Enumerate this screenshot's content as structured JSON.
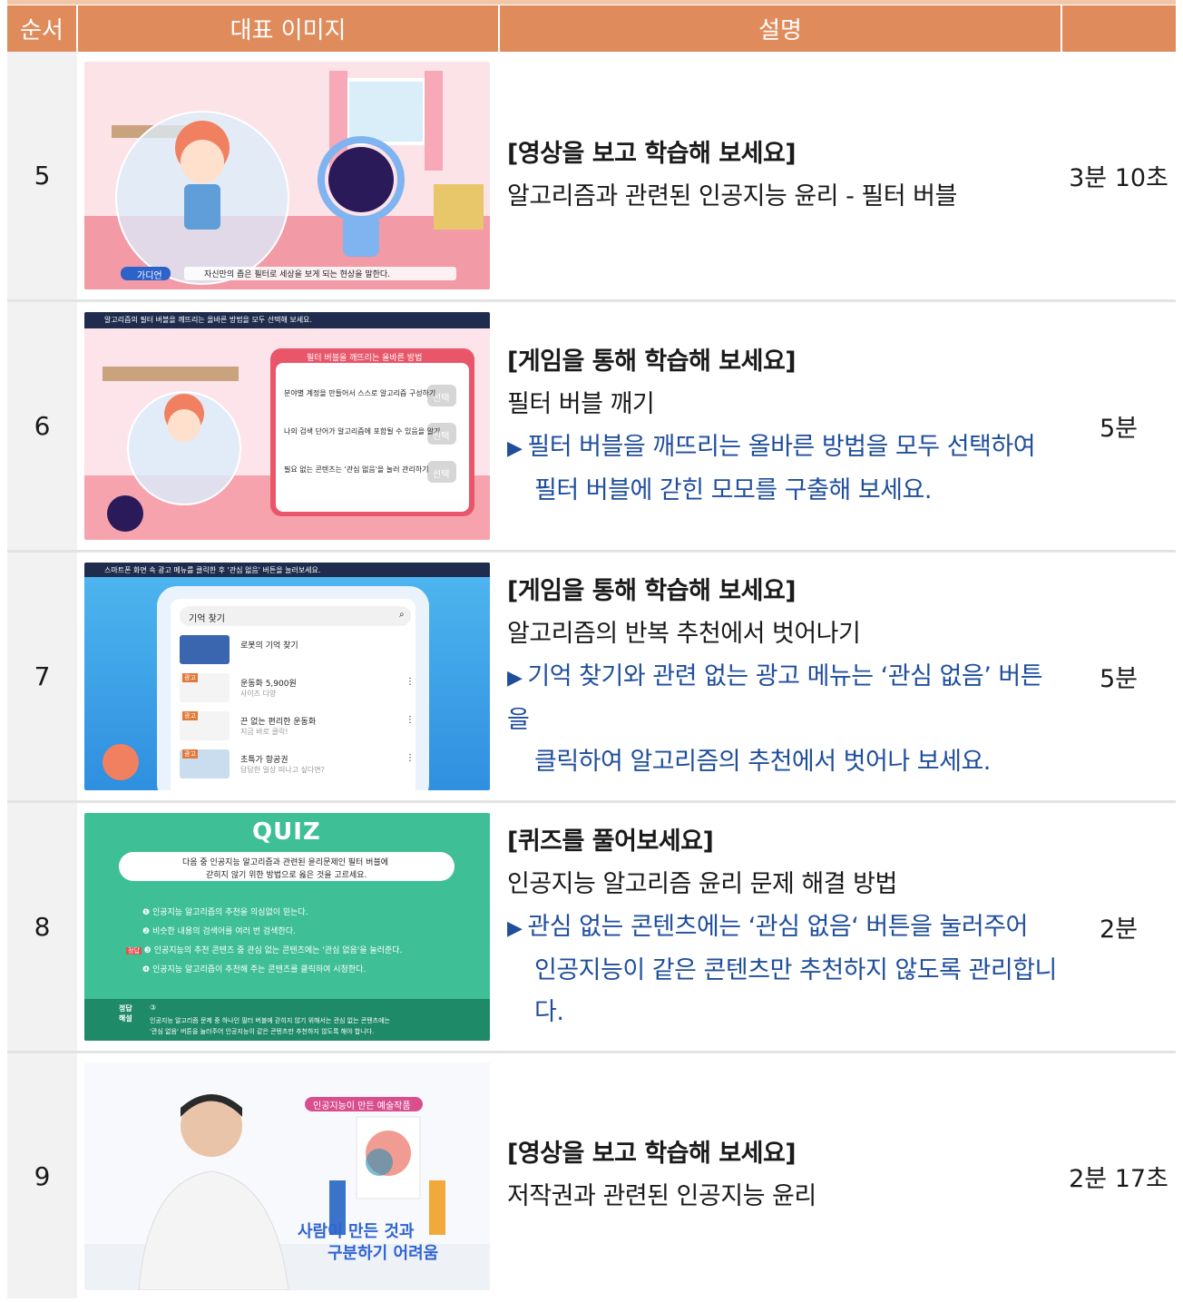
{
  "header": {
    "col_order": "순서",
    "col_image": "대표 이미지",
    "col_desc": "설명",
    "col_time": ""
  },
  "rows": [
    {
      "num": "5",
      "title": "[영상을 보고 학습해 보세요]",
      "subtitle": "알고리즘과 관련된 인공지능 윤리 - 필터 버블",
      "note1": "",
      "note2": "",
      "time": "3분 10초",
      "thumb": {
        "tag": "가디언",
        "caption": "자신만의 좁은 필터로 세상을 보게 되는 현상을 말한다."
      }
    },
    {
      "num": "6",
      "title": "[게임을 통해 학습해 보세요]",
      "subtitle": "필터 버블 깨기",
      "note1": "필터 버블을 깨뜨리는 올바른 방법을 모두 선택하여",
      "note2": "필터 버블에 갇힌 모모를 구출해 보세요.",
      "time": "5분",
      "thumb": {
        "topbar": "알고리즘의 필터 버블을 깨뜨리는 올바른 방법을 모두 선택해 보세요.",
        "panel_title": "필터 버블을 깨뜨리는 올바른 방법",
        "opt1": "분야별 계정을 만들어서 스스로 알고리즘 구성하기",
        "opt2": "나의 검색 단어가 알고리즘에 포함될 수 있음을 알기",
        "opt3": "필요 없는 콘텐츠는 '관심 없음'을 눌러 관리하기",
        "btn": "선택"
      }
    },
    {
      "num": "7",
      "title": "[게임을 통해 학습해 보세요]",
      "subtitle": "알고리즘의 반복 추천에서 벗어나기",
      "note1": "기억 찾기와 관련 없는 광고 메뉴는 ‘관심 없음’ 버튼을",
      "note2": "클릭하여 알고리즘의 추천에서 벗어나 보세요.",
      "time": "5분",
      "thumb": {
        "topbar": "스마트폰 화면 속 광고 메뉴를 클릭한 후 '관심 없음' 버튼을 눌러보세요.",
        "search": "기억 찾기",
        "item1": "로봇의 기억 찾기",
        "item2": "운동화 5,900원",
        "item2s": "사이즈 다양",
        "item3": "끈 없는 편리한 운동화",
        "item3s": "지금 바로 클릭!",
        "item4": "초특가 항공권",
        "item4s": "답답한 일상 떠나고 싶다면?",
        "ad": "광고"
      }
    },
    {
      "num": "8",
      "title": "[퀴즈를 풀어보세요]",
      "subtitle": "인공지능 알고리즘 윤리 문제 해결 방법",
      "note1": "관심 없는 콘텐츠에는 ‘관심 없음‘ 버튼을 눌러주어",
      "note2": "인공지능이 같은 콘텐츠만 추천하지 않도록 관리합니다.",
      "time": "2분",
      "thumb": {
        "logo": "QUIZ",
        "question1": "다음 중 인공지능 알고리즘과 관련된 윤리문제인 필터 버블에",
        "question2": "갇히지 않기 위한 방법으로 옳은 것을 고르세요.",
        "a1": "인공지능 알고리즘의 추천을 의심없이 믿는다.",
        "a2": "비슷한 내용의 검색어를 여러 번 검색한다.",
        "a3": "인공지능의 추천 콘텐츠 중 관심 없는 콘텐츠에는 '관심 없음'을 눌러준다.",
        "a4": "인공지능 알고리즘이 추천해 주는 콘텐츠를 클릭하여 시청한다.",
        "answer_tag": "정답",
        "expl_label": "정답 해설",
        "expl_num": "③",
        "expl1": "인공지능 알고리즘 문제 중 하나인 필터 버블에 갇히지 않기 위해서는 관심 없는 콘텐츠에는",
        "expl2": "'관심 없음' 버튼을 눌러주어 인공지능이 같은 콘텐츠만 추천하지 않도록 해야 합니다."
      }
    },
    {
      "num": "9",
      "title": "[영상을 보고 학습해 보세요]",
      "subtitle": "저작권과 관련된 인공지능 윤리",
      "note1": "",
      "note2": "",
      "time": "2분 17초",
      "thumb": {
        "badge": "인공지능이 만든 예술작품",
        "caption1": "사람이 만든 것과",
        "caption2": "구분하기 어려움"
      }
    }
  ]
}
